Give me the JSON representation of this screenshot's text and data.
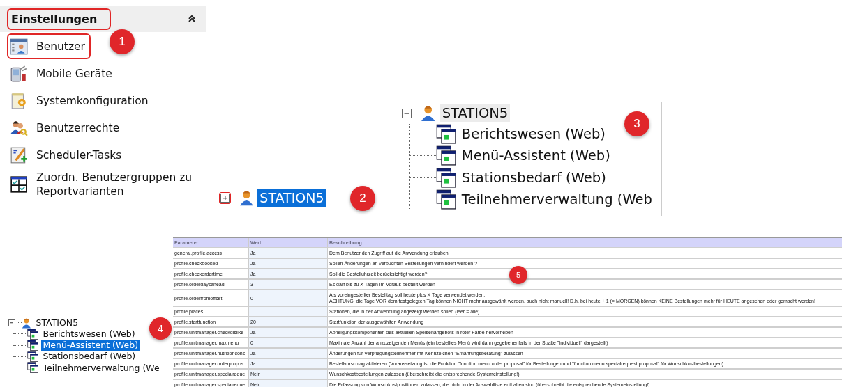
{
  "settings_panel": {
    "header": {
      "label": "Einstellungen",
      "highlighted": true
    },
    "badge": "1",
    "items": [
      {
        "label": "Benutzer",
        "highlighted": true
      },
      {
        "label": "Mobile Geräte",
        "highlighted": false
      },
      {
        "label": "Systemkonfiguration",
        "highlighted": false
      },
      {
        "label": "Benutzerrechte",
        "highlighted": false
      },
      {
        "label": "Scheduler-Tasks",
        "highlighted": false
      },
      {
        "label": "Zuordn. Benutzergruppen zu Reportvarianten",
        "highlighted": false
      }
    ]
  },
  "tree_collapsed": {
    "badge": "2",
    "focused": true,
    "nodes": [
      {
        "label": "STATION5",
        "expanded": false,
        "selected": true,
        "expander_highlighted": true
      }
    ]
  },
  "tree_expanded": {
    "badge": "3",
    "focused": false,
    "nodes": [
      {
        "label": "STATION5",
        "expanded": true,
        "selected": true,
        "expander_highlighted": false,
        "children": [
          {
            "label": "Berichtswesen (Web)",
            "selected": false
          },
          {
            "label": "Menü-Assistent (Web)",
            "selected": false
          },
          {
            "label": "Stationsbedarf (Web)",
            "selected": false
          },
          {
            "label": "Teilnehmerverwaltung (Web",
            "selected": false
          }
        ]
      }
    ]
  },
  "tree_selected": {
    "badge": "4",
    "focused": true,
    "nodes": [
      {
        "label": "STATION5",
        "expanded": true,
        "selected": false,
        "expander_highlighted": false,
        "children": [
          {
            "label": "Berichtswesen (Web)",
            "selected": false
          },
          {
            "label": "Menü-Assistent (Web)",
            "selected": true
          },
          {
            "label": "Stationsbedarf (Web)",
            "selected": false
          },
          {
            "label": "Teilnehmerverwaltung (We",
            "selected": false
          }
        ]
      }
    ]
  },
  "parameter_table": {
    "badge": "5",
    "columns": [
      "Parameter",
      "Wert",
      "Beschreibung"
    ],
    "rows": [
      {
        "parameter": "general.profile.access",
        "value": "Ja",
        "description": "Dem Benutzer den Zugriff auf die Anwendung erlauben"
      },
      {
        "parameter": "profile.checkbooked",
        "value": "Ja",
        "description": "Sollen Änderungen an verbuchten Bestellungen verhindert werden ?"
      },
      {
        "parameter": "profile.checkordertime",
        "value": "Ja",
        "description": "Soll die Bestelluhrzeit berücksichtigt werden?"
      },
      {
        "parameter": "profile.orderdaysahead",
        "value": "3",
        "description": "Es darf bis zu X Tagen im Voraus bestellt werden"
      },
      {
        "parameter": "profile.orderfromoffset",
        "value": "0",
        "description": "Als voreingestellter Bestelltag soll heute plus X Tage verwendet werden.\nACHTUNG: die Tage VOR dem festgelegten Tag können NICHT mehr ausgewählt werden, auch nicht manuell! D.h. bei heute + 1 (= MORGEN) können KEINE Bestellungen mehr für HEUTE angesehen oder gemacht werden!"
      },
      {
        "parameter": "profile.places",
        "value": "",
        "description": "Stationen, die in der Anwendung angezeigt werden sollen (leer = alle)"
      },
      {
        "parameter": "profile.startfunction",
        "value": "20",
        "description": "Startfunktion der ausgewählten Anwendung"
      },
      {
        "parameter": "profile.unitmanager.checkdislike",
        "value": "Ja",
        "description": "Abneigungskomponenten des aktuellen Speisenangebots in roter Farbe hervorheben"
      },
      {
        "parameter": "profile.unitmanager.maxmenu",
        "value": "0",
        "description": "Maximale Anzahl der anzuzeigenden Menüs (ein bestelltes Menü wird dann gegebenenfalls in der Spalte \"Individuell\" dargestellt)"
      },
      {
        "parameter": "profile.unitmanager.nutritioncons",
        "value": "Ja",
        "description": "Änderungen für Verpflegungsteilnehmer mit Kennzeichen \"Ernährungsberatung\" zulassen"
      },
      {
        "parameter": "profile.unitmanager.orderpropos",
        "value": "Ja",
        "description": "Bestellvorschlag aktivieren (Voraussetzung ist die Funktion \"function.menu.order.proposal\" für Bestellungen und \"function.menu.specialrequest.proposal\" für Wunschkostbestellungen)"
      },
      {
        "parameter": "profile.unitmanager.specialreque",
        "value": "Nein",
        "description": "Wunschkostbestellungen zulassen (überschreibt die entsprechende Systemeinstellung!)"
      },
      {
        "parameter": "profile.unitmanager.specialreque",
        "value": "Nein",
        "description": "Die Erfassung von Wunschkostpositionen zulassen, die nicht in der Auswahlliste enthalten sind (überschreibt die entsprechende Systemeinstellung!)"
      }
    ]
  }
}
